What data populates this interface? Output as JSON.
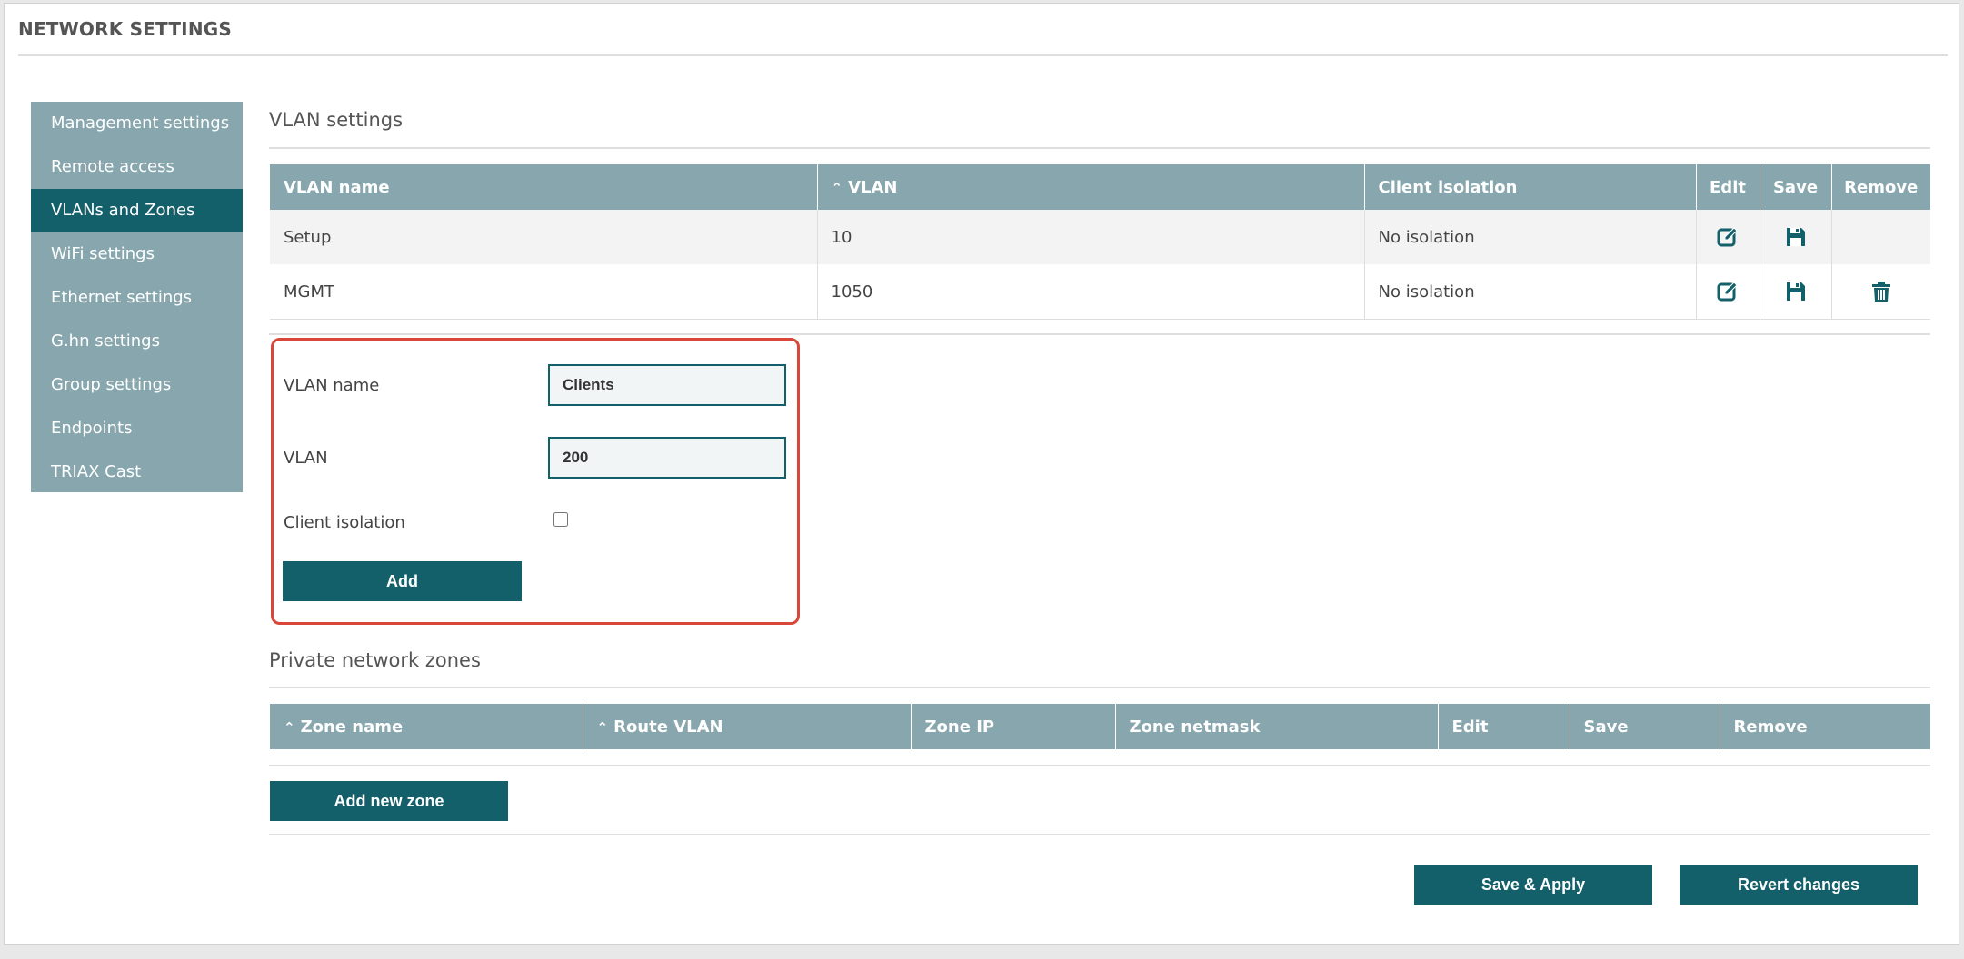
{
  "page": {
    "title": "NETWORK SETTINGS"
  },
  "sidebar": {
    "items": [
      {
        "label": "Management settings"
      },
      {
        "label": "Remote access"
      },
      {
        "label": "VLANs and Zones"
      },
      {
        "label": "WiFi settings"
      },
      {
        "label": "Ethernet settings"
      },
      {
        "label": "G.hn settings"
      },
      {
        "label": "Group settings"
      },
      {
        "label": "Endpoints"
      },
      {
        "label": "TRIAX Cast"
      }
    ],
    "active": "VLANs and Zones"
  },
  "vlan": {
    "section_title": "VLAN settings",
    "table": {
      "headers": {
        "name": "VLAN name",
        "vlan": "VLAN",
        "isolation": "Client isolation",
        "edit": "Edit",
        "save": "Save",
        "remove": "Remove"
      },
      "sorted_column": "VLAN",
      "rows": [
        {
          "name": "Setup",
          "vlan": "10",
          "isolation": "No isolation"
        },
        {
          "name": "MGMT",
          "vlan": "1050",
          "isolation": "No isolation"
        }
      ]
    },
    "form": {
      "name_label": "VLAN name",
      "name_value": "Clients",
      "vlan_label": "VLAN",
      "vlan_value": "200",
      "isolation_label": "Client isolation",
      "isolation_checked": false,
      "add_label": "Add"
    }
  },
  "zones": {
    "section_title": "Private network zones",
    "table": {
      "headers": {
        "name": "Zone name",
        "route": "Route VLAN",
        "ip": "Zone IP",
        "netmask": "Zone netmask",
        "edit": "Edit",
        "save": "Save",
        "remove": "Remove"
      },
      "sorted_columns": [
        "Zone name",
        "Route VLAN"
      ]
    },
    "add_zone_label": "Add new zone"
  },
  "footer": {
    "save_apply_label": "Save & Apply",
    "revert_label": "Revert changes"
  },
  "colors": {
    "accent": "#135f6a",
    "header": "#87a6ad",
    "highlight_border": "#d9473a"
  }
}
